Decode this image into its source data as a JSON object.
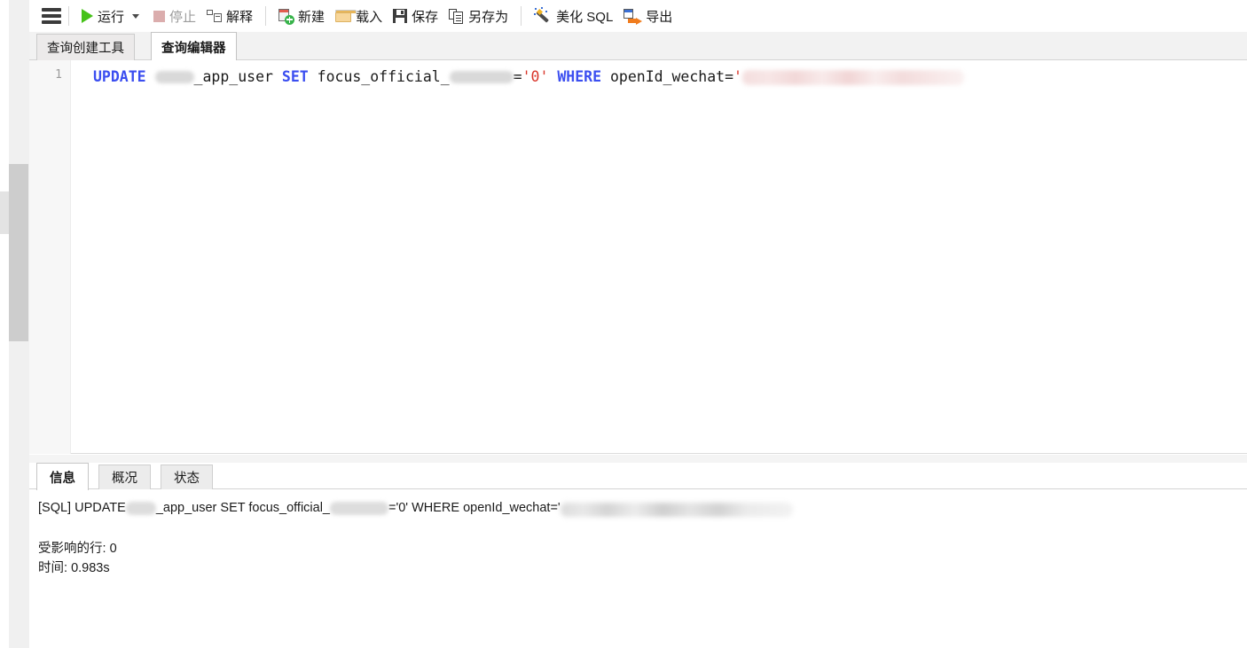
{
  "toolbar": {
    "menu_icon": "hamburger-icon",
    "items": [
      {
        "id": "run",
        "label": "运行",
        "icon": "play-icon",
        "disabled": false,
        "has_caret": true
      },
      {
        "id": "stop",
        "label": "停止",
        "icon": "stop-icon",
        "disabled": true,
        "has_caret": false
      },
      {
        "id": "explain",
        "label": "解释",
        "icon": "explain-icon",
        "disabled": false,
        "has_caret": false
      },
      {
        "id": "new",
        "label": "新建",
        "icon": "new-file-icon",
        "disabled": false,
        "has_caret": false
      },
      {
        "id": "load",
        "label": "载入",
        "icon": "folder-icon",
        "disabled": false,
        "has_caret": false
      },
      {
        "id": "save",
        "label": "保存",
        "icon": "save-icon",
        "disabled": false,
        "has_caret": false
      },
      {
        "id": "save_as",
        "label": "另存为",
        "icon": "save-as-icon",
        "disabled": false,
        "has_caret": false
      },
      {
        "id": "beautify",
        "label": "美化 SQL",
        "icon": "magic-wand-icon",
        "disabled": false,
        "has_caret": false
      },
      {
        "id": "export",
        "label": "导出",
        "icon": "export-icon",
        "disabled": false,
        "has_caret": false
      }
    ]
  },
  "editor_tabs": [
    {
      "id": "query_builder",
      "label": "查询创建工具",
      "active": false
    },
    {
      "id": "query_editor",
      "label": "查询编辑器",
      "active": true
    }
  ],
  "editor": {
    "line_number": "1",
    "sql": {
      "kw_update": "UPDATE",
      "table_suffix": "_app_user",
      "kw_set": "SET",
      "column_prefix": "focus_official_",
      "assign_op": "=",
      "value": "'0'",
      "kw_where": "WHERE",
      "where_column": "openId_wechat",
      "where_op": "=",
      "quote": "'"
    }
  },
  "result_tabs": [
    {
      "id": "info",
      "label": "信息",
      "active": true
    },
    {
      "id": "profile",
      "label": "概况",
      "active": false
    },
    {
      "id": "status",
      "label": "状态",
      "active": false
    }
  ],
  "result": {
    "sql_prefix": "[SQL] UPDATE",
    "sql_mid1": "_app_user SET focus_official_",
    "sql_mid2": "='0' WHERE openId_wechat='",
    "affected_rows_label": "受影响的行:",
    "affected_rows_value": "0",
    "time_label": "时间:",
    "time_value": "0.983s"
  },
  "colors": {
    "keyword": "#3b4ef0",
    "string": "#d9362b",
    "run_green": "#46c219",
    "export_orange": "#f07c1e",
    "tab_active_bg": "#ffffff",
    "tab_inactive_bg": "#ececec",
    "gutter_bg": "#f7f7f7",
    "scrollbar_thumb": "#cdcdcd"
  }
}
